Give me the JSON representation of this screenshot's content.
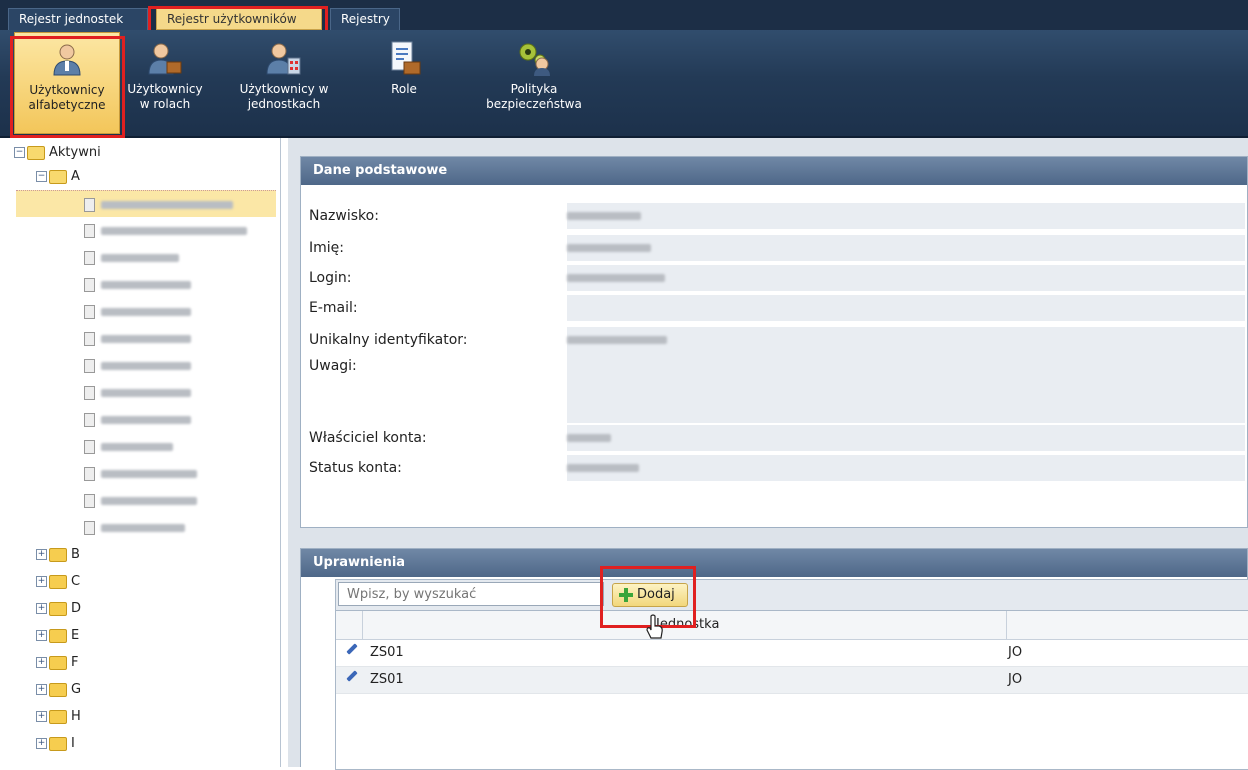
{
  "top_tabs": [
    "Rejestr jednostek",
    "Rejestr użytkowników",
    "Rejestry"
  ],
  "ribbon": [
    {
      "label_line1": "Użytkownicy",
      "label_line2": "alfabetyczne",
      "icon": "user-icon"
    },
    {
      "label_line1": "Użytkownicy",
      "label_line2": "w rolach",
      "icon": "user-role-icon"
    },
    {
      "label_line1": "Użytkownicy w",
      "label_line2": "jednostkach",
      "icon": "user-unit-icon"
    },
    {
      "label_line1": "Role",
      "label_line2": "",
      "icon": "document-role-icon"
    },
    {
      "label_line1": "Polityka",
      "label_line2": "bezpieczeństwa",
      "icon": "security-policy-icon"
    }
  ],
  "tree": {
    "root": "Aktywni",
    "expanded_letter": "A",
    "collapsed_letters": [
      "B",
      "C",
      "D",
      "E",
      "F",
      "G",
      "H",
      "I"
    ]
  },
  "dane": {
    "title": "Dane podstawowe",
    "fields": [
      "Nazwisko:",
      "Imię:",
      "Login:",
      "E-mail:",
      "Unikalny identyfikator:",
      "Uwagi:",
      "Właściciel konta:",
      "Status konta:"
    ]
  },
  "uprawnienia": {
    "title": "Uprawnienia",
    "search_placeholder": "Wpisz, by wyszukać",
    "add_label": "Dodaj",
    "column_header": "Jednostka",
    "rows": [
      {
        "unit": "ZS01",
        "role": "JO"
      },
      {
        "unit": "ZS01",
        "role": "JO"
      }
    ]
  }
}
